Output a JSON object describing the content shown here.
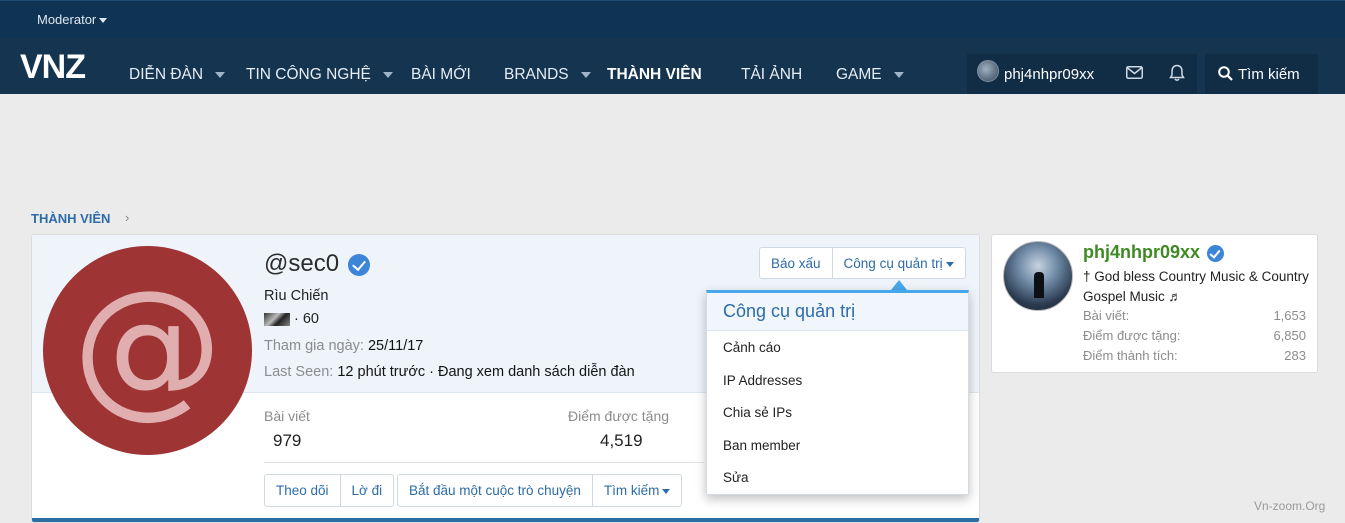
{
  "modbar": {
    "label": "Moderator"
  },
  "nav": {
    "logo": "VNZ",
    "items": [
      {
        "label": "DIỄN ĐÀN"
      },
      {
        "label": "TIN CÔNG NGHỆ"
      },
      {
        "label": "BÀI MỚI"
      },
      {
        "label": "BRANDS"
      },
      {
        "label": "THÀNH VIÊN"
      },
      {
        "label": "TẢI ẢNH"
      },
      {
        "label": "GAME"
      }
    ],
    "username": "phj4nhpr09xx",
    "search_label": "Tìm kiếm"
  },
  "breadcrumb": {
    "label": "THÀNH VIÊN"
  },
  "profile": {
    "handle": "@sec0",
    "avatar_letter": "@",
    "rank": "Rìu Chiến",
    "level": "· 60",
    "joined_label": "Tham gia ngày:",
    "joined_value": "25/11/17",
    "seen_label": "Last Seen:",
    "seen_value": "12 phút trước · Đang xem danh sách diễn đàn",
    "stats": [
      {
        "label": "Bài viết",
        "value": "979"
      },
      {
        "label": "Điểm được tặng",
        "value": "4,519"
      }
    ],
    "actions": {
      "follow": "Theo dõi",
      "ignore": "Lờ đi",
      "start_convo": "Bắt đầu một cuộc trò chuyện",
      "find": "Tìm kiếm"
    },
    "report": "Báo xấu",
    "admin_tools": "Công cụ quản trị"
  },
  "menu": {
    "title": "Công cụ quản trị",
    "items": [
      "Cảnh cáo",
      "IP Addresses",
      "Chia sẻ IPs",
      "Ban member",
      "Sửa"
    ]
  },
  "sidebar": {
    "name": "phj4nhpr09xx",
    "title": "† God bless Country Music & Country Gospel Music ♬",
    "stats": [
      {
        "label": "Bài viết:",
        "value": "1,653"
      },
      {
        "label": "Điểm được tặng:",
        "value": "6,850"
      },
      {
        "label": "Điểm thành tích:",
        "value": "283"
      }
    ]
  },
  "watermark": "Vn-zoom.Org",
  "colors": {
    "nav_bg": "#15344f",
    "accent": "#2d6ca8",
    "avatar_bg": "#9f3434",
    "username_green": "#3f8a24"
  }
}
